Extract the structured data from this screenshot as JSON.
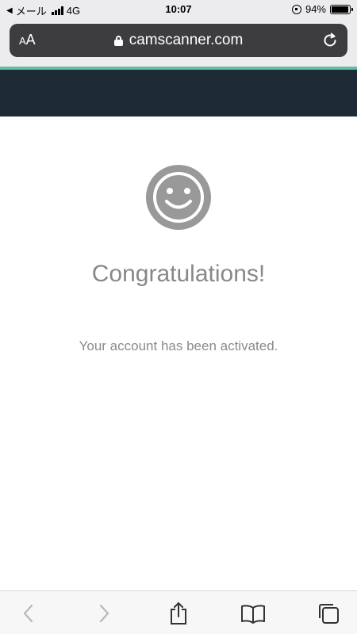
{
  "status_bar": {
    "carrier": "メール",
    "network": "4G",
    "time": "10:07",
    "battery_percent": "94%",
    "battery_level": 0.94
  },
  "url_bar": {
    "text_size_label": "AA",
    "domain": "camscanner.com"
  },
  "site": {
    "header_color": "#1f2a37",
    "accent_color": "#5fbfa0"
  },
  "main": {
    "icon": "smiley-icon",
    "title": "Congratulations!",
    "message": "Your account has been activated."
  },
  "toolbar": {
    "items": [
      "back-icon",
      "forward-icon",
      "share-icon",
      "bookmarks-icon",
      "tabs-icon"
    ]
  }
}
